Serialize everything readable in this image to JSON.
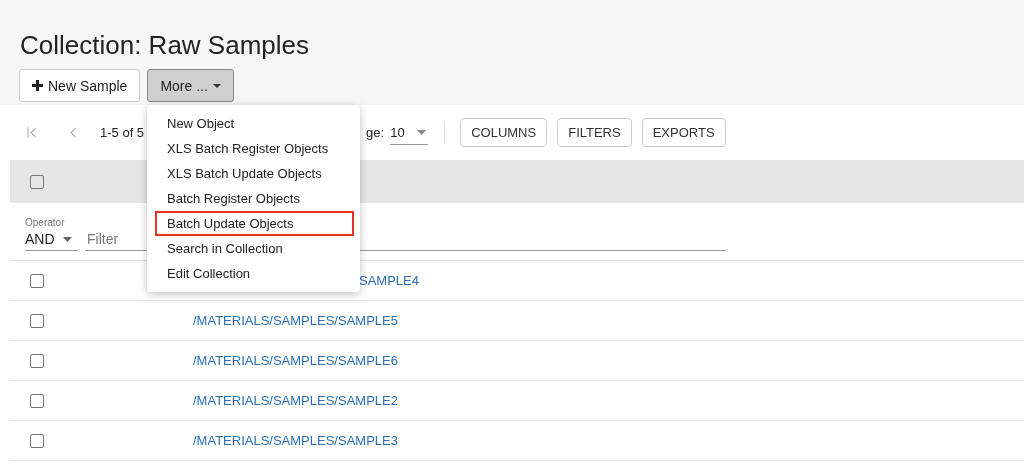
{
  "title": "Collection: Raw Samples",
  "actions": [
    {
      "kind": "plus",
      "label": "New Sample",
      "pressed": false
    },
    {
      "kind": "dropdown",
      "label": "More ...",
      "pressed": true
    }
  ],
  "menu": [
    {
      "label": "New Object",
      "highlighted": false
    },
    {
      "label": "XLS Batch Register Objects",
      "highlighted": false
    },
    {
      "label": "XLS Batch Update Objects",
      "highlighted": false
    },
    {
      "label": "Batch Register Objects",
      "highlighted": false
    },
    {
      "label": "Batch Update Objects",
      "highlighted": true
    },
    {
      "label": "Search in Collection",
      "highlighted": false
    },
    {
      "label": "Edit Collection",
      "highlighted": false
    }
  ],
  "pagination": {
    "range": "1-5 of 5",
    "page_size_label": "ge:",
    "page_size": "10"
  },
  "tools": [
    "COLUMNS",
    "FILTERS",
    "EXPORTS"
  ],
  "header": {
    "select_all": false
  },
  "filter": {
    "operator_label": "Operator",
    "operator": "AND",
    "placeholder": "Filter"
  },
  "rows": [
    {
      "checked": false,
      "path": "SAMPLE4"
    },
    {
      "checked": false,
      "path": "/MATERIALS/SAMPLES/SAMPLE5"
    },
    {
      "checked": false,
      "path": "/MATERIALS/SAMPLES/SAMPLE6"
    },
    {
      "checked": false,
      "path": "/MATERIALS/SAMPLES/SAMPLE2"
    },
    {
      "checked": false,
      "path": "/MATERIALS/SAMPLES/SAMPLE3"
    }
  ]
}
